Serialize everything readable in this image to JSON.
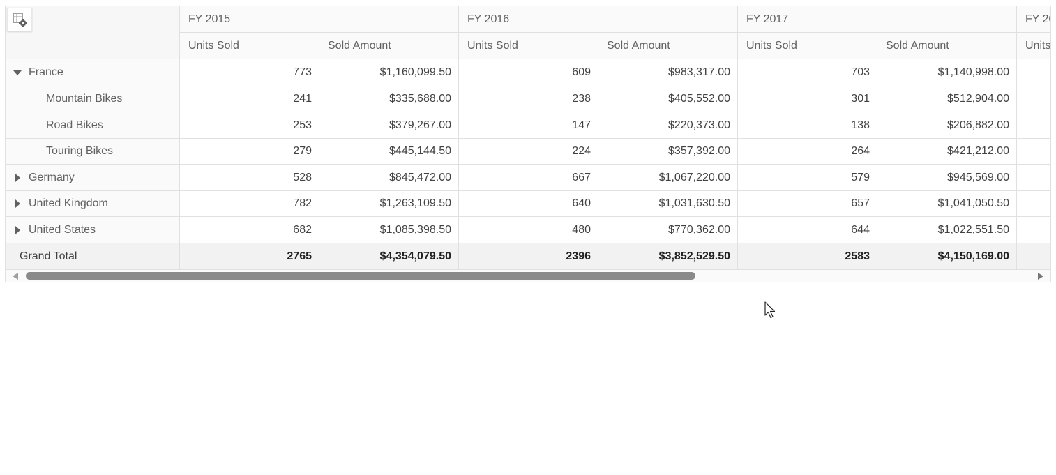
{
  "pivot": {
    "years": [
      "FY 2015",
      "FY 2016",
      "FY 2017",
      "FY 20"
    ],
    "measures": [
      "Units Sold",
      "Sold Amount"
    ],
    "rows": [
      {
        "label": "France",
        "level": 0,
        "expander": "expanded",
        "values": [
          "773",
          "$1,160,099.50",
          "609",
          "$983,317.00",
          "703",
          "$1,140,998.00"
        ]
      },
      {
        "label": "Mountain Bikes",
        "level": 1,
        "expander": "none",
        "values": [
          "241",
          "$335,688.00",
          "238",
          "$405,552.00",
          "301",
          "$512,904.00"
        ]
      },
      {
        "label": "Road Bikes",
        "level": 1,
        "expander": "none",
        "values": [
          "253",
          "$379,267.00",
          "147",
          "$220,373.00",
          "138",
          "$206,882.00"
        ]
      },
      {
        "label": "Touring Bikes",
        "level": 1,
        "expander": "none",
        "values": [
          "279",
          "$445,144.50",
          "224",
          "$357,392.00",
          "264",
          "$421,212.00"
        ]
      },
      {
        "label": "Germany",
        "level": 0,
        "expander": "collapsed",
        "values": [
          "528",
          "$845,472.00",
          "667",
          "$1,067,220.00",
          "579",
          "$945,569.00"
        ]
      },
      {
        "label": "United Kingdom",
        "level": 0,
        "expander": "collapsed",
        "values": [
          "782",
          "$1,263,109.50",
          "640",
          "$1,031,630.50",
          "657",
          "$1,041,050.50"
        ]
      },
      {
        "label": "United States",
        "level": 0,
        "expander": "collapsed",
        "values": [
          "682",
          "$1,085,398.50",
          "480",
          "$770,362.00",
          "644",
          "$1,022,551.50"
        ]
      }
    ],
    "grand_total": {
      "label": "Grand Total",
      "values": [
        "2765",
        "$4,354,079.50",
        "2396",
        "$3,852,529.50",
        "2583",
        "$4,150,169.00"
      ]
    },
    "toolbar_icon": "grid-settings-icon",
    "colors": {
      "border": "#e0e0e0",
      "header_bg": "#fafafa",
      "total_bg": "#f2f2f2",
      "scroll_thumb": "#8a8a8a"
    }
  }
}
